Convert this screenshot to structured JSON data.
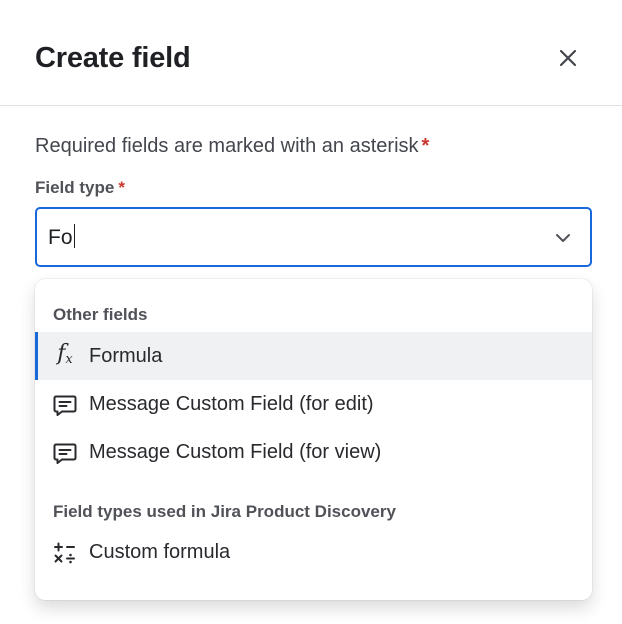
{
  "header": {
    "title": "Create field",
    "close_icon": "close-icon"
  },
  "form": {
    "required_note": "Required fields are marked with an asterisk",
    "asterisk": "*",
    "field_type_label": "Field type",
    "field_type_value": "Fo"
  },
  "dropdown": {
    "groups": [
      {
        "heading": "Other fields",
        "options": [
          {
            "label": "Formula",
            "icon": "formula-icon",
            "selected": true
          },
          {
            "label": "Message Custom Field (for edit)",
            "icon": "message-icon",
            "selected": false
          },
          {
            "label": "Message Custom Field (for view)",
            "icon": "message-icon",
            "selected": false
          }
        ]
      },
      {
        "heading": "Field types used in Jira Product Discovery",
        "options": [
          {
            "label": "Custom formula",
            "icon": "calculator-icon",
            "selected": false
          }
        ]
      }
    ]
  },
  "colors": {
    "accent": "#1868db",
    "required": "#c9372c",
    "selected_bg": "#f0f1f2"
  }
}
